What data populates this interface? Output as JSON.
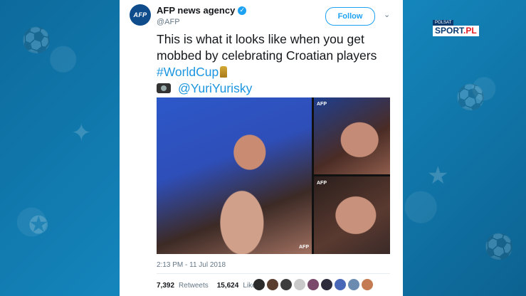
{
  "account": {
    "name": "AFP news agency",
    "handle": "@AFP",
    "avatar_text": "AFP"
  },
  "follow_label": "Follow",
  "tweet": {
    "line1": "This is what it looks like when you get",
    "line2": "mobbed by celebrating Croatian players",
    "hashtag": "#WorldCup",
    "mention": "@YuriYurisky"
  },
  "media_watermarks": {
    "main_caption": "AFP",
    "top_right": "AFP",
    "bottom_right": "AFP"
  },
  "timestamp": "2:13 PM - 11 Jul 2018",
  "stats": {
    "retweets_count": "7,392",
    "retweets_label": "Retweets",
    "likes_count": "15,624",
    "likes_label": "Likes"
  },
  "liker_colors": [
    "#2b2b2b",
    "#5a3f30",
    "#3e3e3e",
    "#c9c9c9",
    "#7a4b6a",
    "#2c2c3c",
    "#4a68b8",
    "#6b8bb0",
    "#c47b52"
  ],
  "broadcaster": {
    "top": "POLSAT",
    "brand": "SPORT",
    "suffix": ".PL"
  },
  "colors": {
    "accent": "#1da1f2",
    "link": "#1b95e0",
    "background": "#0f74a8"
  },
  "icons": [
    "verified-icon",
    "chevron-down-icon",
    "trophy-icon",
    "camera-icon"
  ]
}
